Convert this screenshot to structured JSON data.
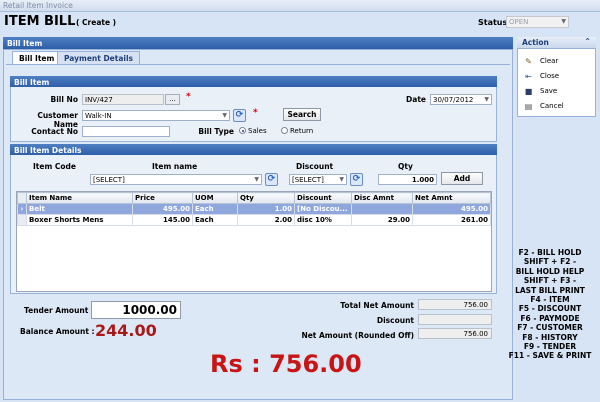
{
  "window": {
    "title": "Retail Item Invoice"
  },
  "header": {
    "title": "ITEM BILL",
    "mode": "( Create )",
    "status_label": "Status",
    "status_value": "OPEN"
  },
  "main_panel": {
    "title": "Bill Item"
  },
  "tabs": [
    {
      "label": "Bill Item",
      "active": true
    },
    {
      "label": "Payment Details",
      "active": false
    }
  ],
  "bill_item": {
    "title": "Bill Item",
    "bill_no_label": "Bill No",
    "bill_no_value": "INV/427",
    "browse_label": "...",
    "customer_label": "Customer Name",
    "customer_value": "Walk-IN",
    "search_label": "Search",
    "contact_label": "Contact No",
    "contact_value": "",
    "date_label": "Date",
    "date_value": "30/07/2012",
    "bill_type_label": "Bill Type",
    "bill_type_options": [
      "Sales",
      "Return"
    ],
    "bill_type_selected": "Sales"
  },
  "bill_item_details": {
    "title": "Bill Item Details",
    "item_code_label": "Item Code",
    "item_name_label": "Item name",
    "discount_label": "Discount",
    "qty_label": "Qty",
    "item_select": "[SELECT]",
    "discount_select": "[SELECT]",
    "qty_value": "1.000",
    "add_label": "Add",
    "columns": [
      "Item Name",
      "Price",
      "UOM",
      "Qty",
      "Discount",
      "Disc Amnt",
      "Net Amnt"
    ],
    "rows": [
      {
        "name": "Belt",
        "price": "495.00",
        "uom": "Each",
        "qty": "1.00",
        "discount": "[No Discou...",
        "disc_amnt": "",
        "net_amnt": "495.00",
        "selected": true
      },
      {
        "name": "Boxer Shorts Mens",
        "price": "145.00",
        "uom": "Each",
        "qty": "2.00",
        "discount": "disc 10%",
        "disc_amnt": "29.00",
        "net_amnt": "261.00",
        "selected": false
      }
    ]
  },
  "payment": {
    "tender_label": "Tender Amount",
    "tender_value": "1000.00",
    "balance_label": "Balance Amount :",
    "balance_value": "244.00",
    "total_net_label": "Total Net Amount",
    "total_net_value": "756.00",
    "discount_label": "Discount",
    "discount_value": "",
    "net_rounded_label": "Net Amount (Rounded Off)",
    "net_rounded_value": "756.00",
    "grand_total": "Rs : 756.00"
  },
  "actions": {
    "title": "Action",
    "items": [
      {
        "label": "Clear",
        "icon": "broom-icon"
      },
      {
        "label": "Close",
        "icon": "close-icon"
      },
      {
        "label": "Save",
        "icon": "save-icon"
      },
      {
        "label": "Cancel",
        "icon": "cancel-icon"
      }
    ]
  },
  "shortcuts": [
    "F2 - BILL HOLD",
    "SHIFT + F2 -",
    "BILL HOLD HELP",
    "SHIFT + F3 -",
    "LAST BILL PRINT",
    "F4 - ITEM",
    "F5 - DISCOUNT",
    "F6 - PAYMODE",
    "F7 - CUSTOMER",
    "F8 - HISTORY",
    "F9 - TENDER",
    "F11 - SAVE & PRINT"
  ],
  "colors": {
    "header_blue": "#2d5ea8",
    "balance_red": "#a81a1a",
    "total_red": "#c81414",
    "selected_row": "#8fa7dd"
  }
}
